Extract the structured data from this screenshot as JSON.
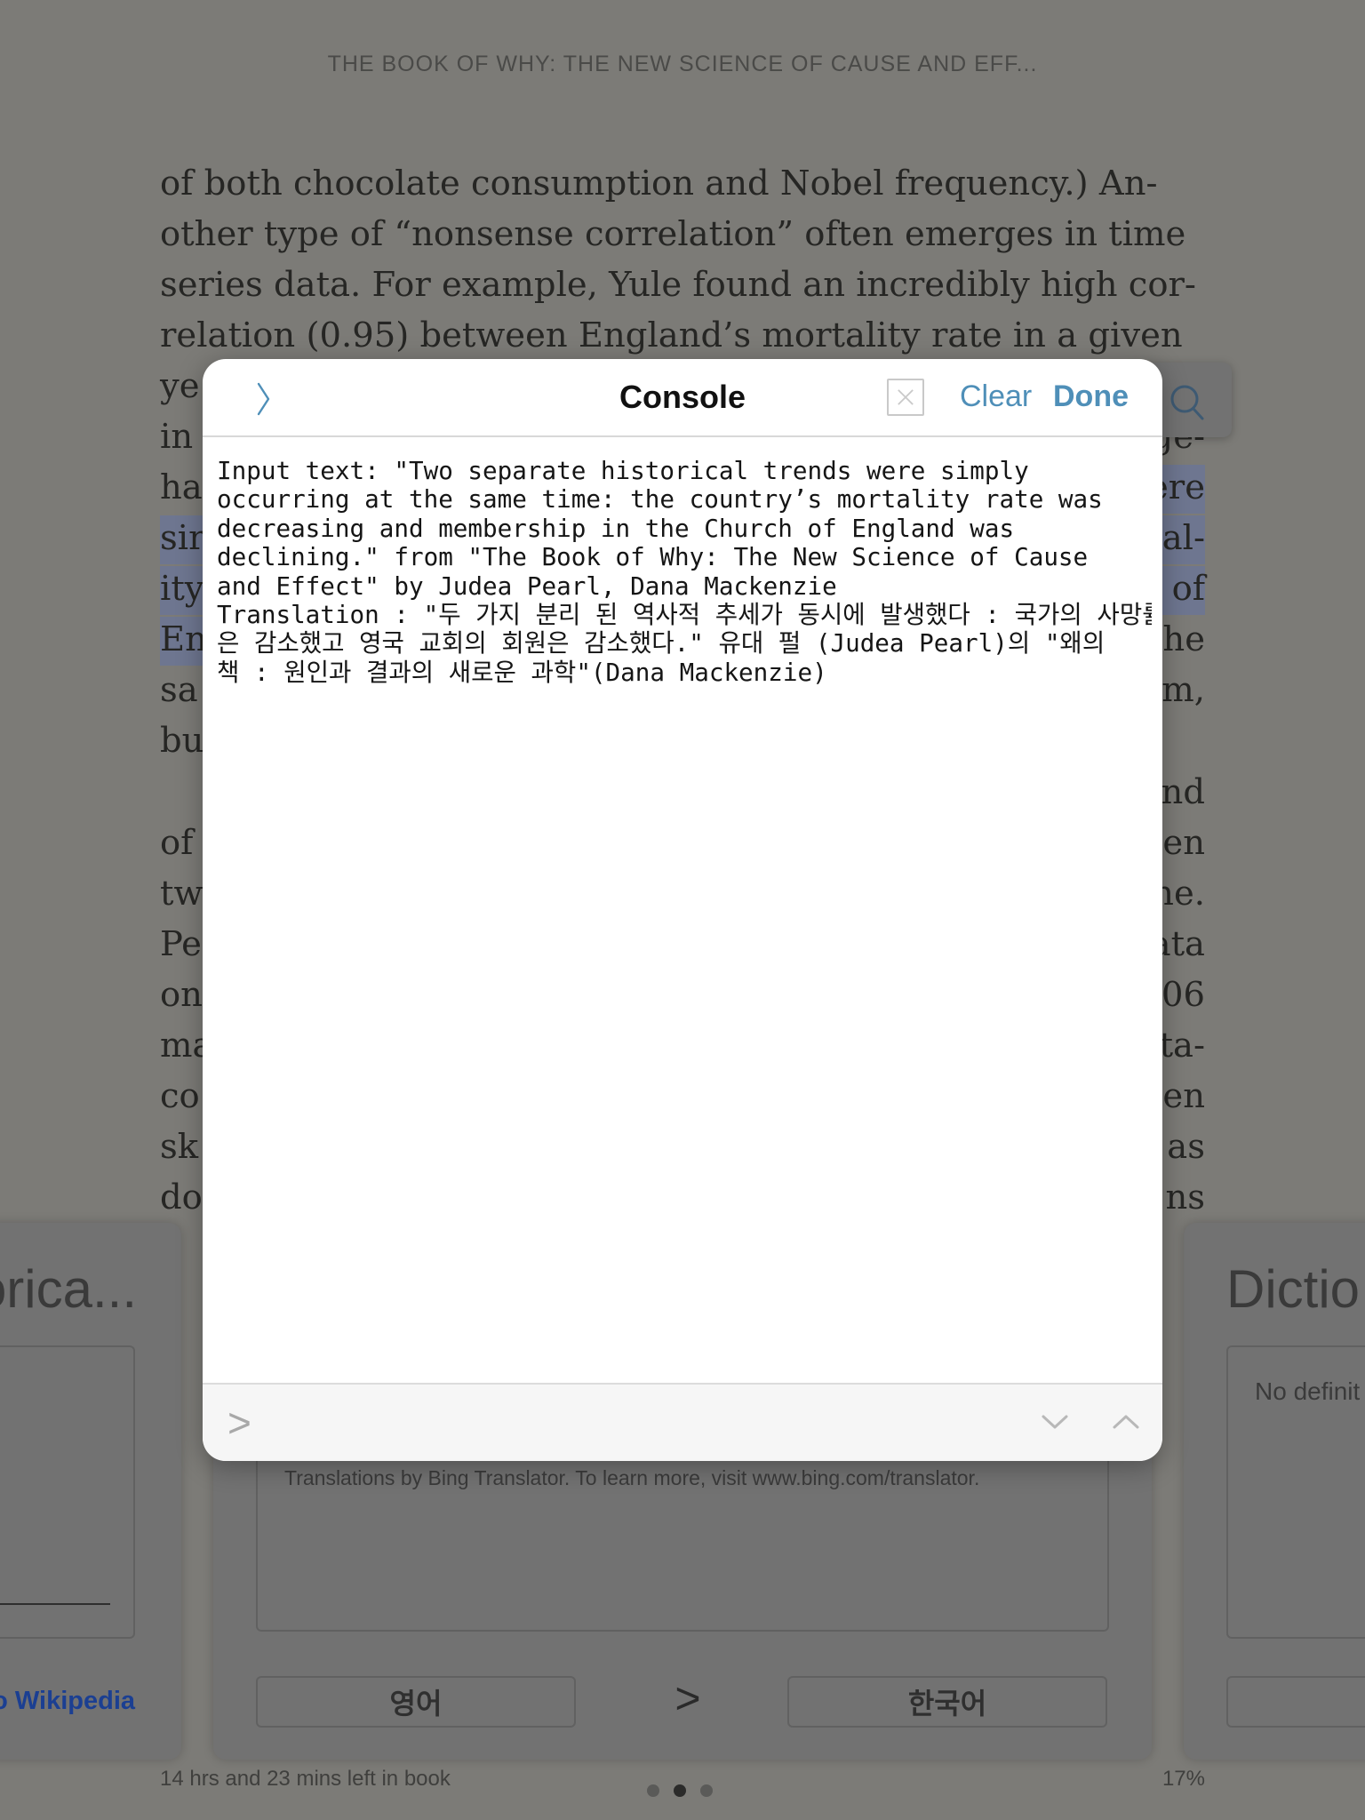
{
  "reader": {
    "book_title": "THE BOOK OF WHY: THE NEW SCIENCE OF CAUSE AND EFF...",
    "full_lines": [
      "of both chocolate consumption and Nobel frequency.) An-",
      "other type of “nonsense correlation” often emerges in time",
      "series data. For example, Yule found an incredibly high cor-",
      "relation (0.95) between England’s mortality rate in a given"
    ],
    "left_fragments": [
      "ye",
      "in",
      "ha",
      "sir",
      "ity",
      "En",
      "sa",
      "bu",
      "",
      "of",
      "tw",
      "Pe",
      "on",
      "ma",
      "co",
      "sk",
      "do"
    ],
    "right_fragments": [
      "",
      "ge-",
      "ere",
      "al-",
      "of",
      "he",
      "m,",
      "",
      "nd",
      "en",
      "ne.",
      "ata",
      "06",
      "ta-",
      "en",
      "as",
      "ns"
    ],
    "time_left": "14 hrs and 23 mins left in book",
    "percent": "17%"
  },
  "lookup_cards": {
    "left_title": "orica...",
    "left_link": "o Wikipedia",
    "translation_credit": "Translations by Bing Translator. To learn more, visit www.bing.com/translator.",
    "source_language": "영어",
    "target_language": "한국어",
    "arrow": ">",
    "right_title": "Dictio",
    "right_body": "No definit"
  },
  "console": {
    "title": "Console",
    "clear_label": "Clear",
    "done_label": "Done",
    "output": "Input text: \"Two separate historical trends were simply\noccurring at the same time: the country’s mortality rate was\ndecreasing and membership in the Church of England was\ndeclining.\" from \"The Book of Why: The New Science of Cause\nand Effect\" by Judea Pearl, Dana Mackenzie\nTranslation : \"두 가지 분리 된 역사적 추세가 동시에 발생했다 : 국가의 사망률\n은 감소했고 영국 교회의 회원은 감소했다.\" 유대 펄 (Judea Pearl)의 \"왜의\n책 : 원인과 결과의 새로운 과학\"(Dana Mackenzie)",
    "prompt": ">",
    "accent_color": "#4f8fb8"
  }
}
